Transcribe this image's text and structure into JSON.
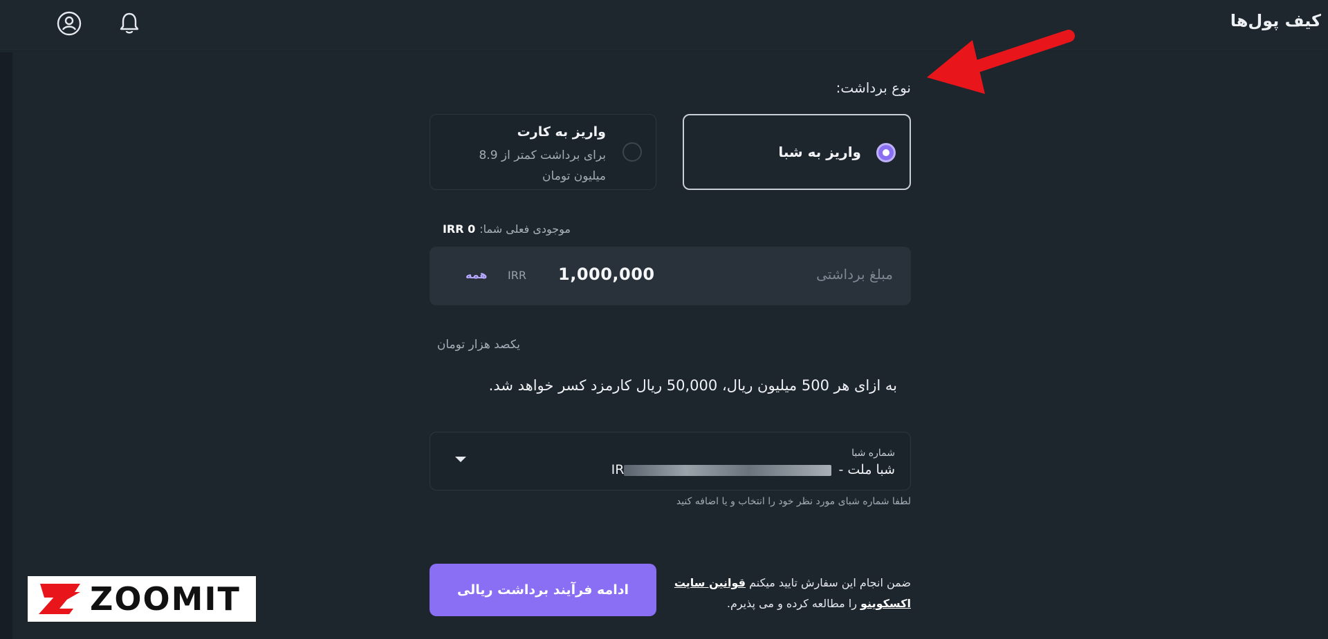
{
  "header": {
    "title": "کیف پول‌ها"
  },
  "withdraw_type": {
    "label": "نوع برداشت:",
    "options": [
      {
        "title": "واریز به شبا",
        "selected": true
      },
      {
        "title": "واریز به کارت",
        "description": "برای برداشت کمتر از 8.9 میلیون تومان",
        "selected": false
      }
    ]
  },
  "balance": {
    "label": "موجودی فعلی شما:",
    "value": "IRR 0"
  },
  "amount": {
    "placeholder": "مبلغ برداشتی",
    "value": "1,000,000",
    "currency": "IRR",
    "all_label": "همه",
    "in_words": "یکصد هزار تومان"
  },
  "fee_note": "به ازای هر 500 میلیون ریال، 50,000 ریال کارمزد کسر خواهد شد.",
  "sheba": {
    "label": "شماره شبا",
    "value_prefix": "شبا ملت -",
    "value_code": "IR",
    "hint": "لطفا شماره شبای مورد نظر خود را انتخاب و یا اضافه کنید"
  },
  "terms": {
    "before": "ضمن انجام این سفارش تایید میکنم",
    "link": "قوانین سایت اکسکوینو",
    "after": "را مطالعه کرده و می پذیرم."
  },
  "continue_button": "ادامه فرآیند برداشت ریالی",
  "watermark": "ZOOMIT",
  "colors": {
    "accent": "#8a6ef3",
    "background": "#1c242c",
    "annotation_arrow": "#e8161b"
  },
  "icons": {
    "user": "user-circle-icon",
    "notification": "bell-icon",
    "dropdown": "chevron-down-icon"
  }
}
